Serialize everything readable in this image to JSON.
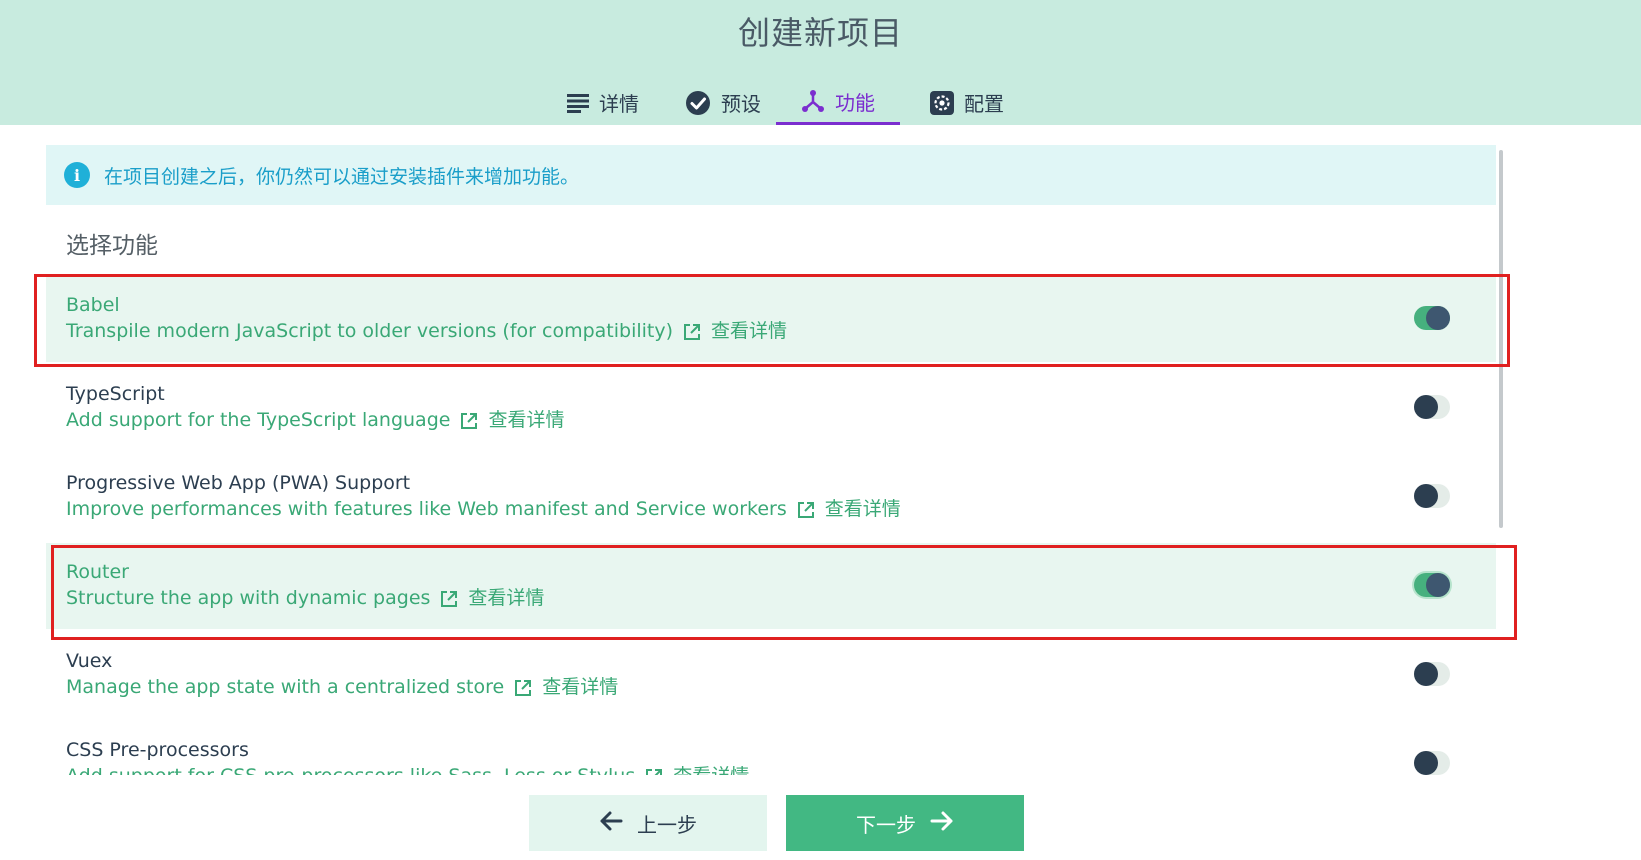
{
  "header": {
    "title": "创建新项目",
    "tabs": [
      {
        "label": "详情",
        "icon": "list-icon",
        "active": false
      },
      {
        "label": "预设",
        "icon": "check-circle-icon",
        "active": false
      },
      {
        "label": "功能",
        "icon": "fork-icon",
        "active": true
      },
      {
        "label": "配置",
        "icon": "gear-icon",
        "active": false
      }
    ]
  },
  "info": {
    "icon": "info-icon",
    "text": "在项目创建之后，你仍然可以通过安装插件来增加功能。"
  },
  "section_title": "选择功能",
  "features": [
    {
      "name": "Babel",
      "description": "Transpile modern JavaScript to older versions (for compatibility)",
      "link": "查看详情",
      "enabled": true
    },
    {
      "name": "TypeScript",
      "description": "Add support for the TypeScript language",
      "link": "查看详情",
      "enabled": false
    },
    {
      "name": "Progressive Web App (PWA) Support",
      "description": "Improve performances with features like Web manifest and Service workers",
      "link": "查看详情",
      "enabled": false
    },
    {
      "name": "Router",
      "description": "Structure the app with dynamic pages",
      "link": "查看详情",
      "enabled": true
    },
    {
      "name": "Vuex",
      "description": "Manage the app state with a centralized store",
      "link": "查看详情",
      "enabled": false
    },
    {
      "name": "CSS Pre-processors",
      "description": "Add support for CSS pre-processors like Sass, Less or Stylus",
      "link": "查看详情",
      "enabled": false
    }
  ],
  "footer": {
    "prev_label": "上一步",
    "next_label": "下一步"
  },
  "colors": {
    "header_bg": "#c8ebdf",
    "accent_green": "#42b883",
    "active_tab": "#7b2ecf",
    "info_text": "#1a9ec9",
    "highlight_border": "#e02020"
  }
}
